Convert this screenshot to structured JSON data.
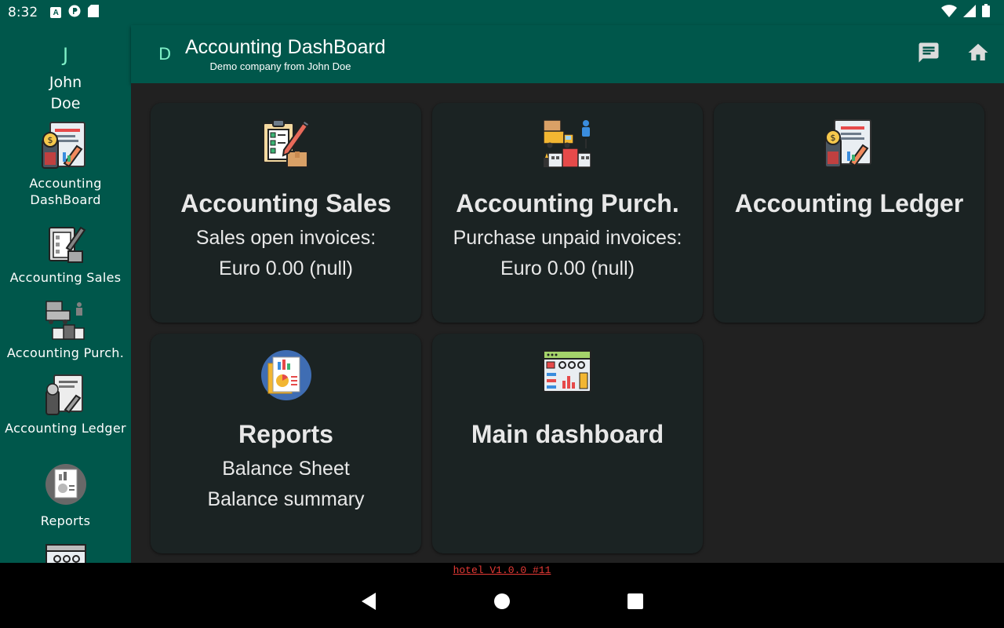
{
  "status_bar": {
    "time": "8:32",
    "icons": [
      "a-icon",
      "p-icon",
      "sd-card-icon"
    ],
    "right_icons": [
      "wifi-icon",
      "signal-icon",
      "battery-icon"
    ]
  },
  "sidebar": {
    "user_initial": "J",
    "user_first": "John",
    "user_last": "Doe",
    "items": [
      {
        "label": "Accounting DashBoard",
        "label_line1": "Accounting",
        "label_line2": "DashBoard",
        "icon": "accounting-dashboard-icon"
      },
      {
        "label": "Accounting Sales",
        "icon": "sales-clipboard-icon"
      },
      {
        "label": "Accounting Purch.",
        "icon": "purchase-truck-icon"
      },
      {
        "label": "Accounting Ledger",
        "icon": "ledger-icon"
      },
      {
        "label": "Reports",
        "icon": "reports-icon"
      },
      {
        "label": "",
        "icon": "main-dashboard-icon"
      }
    ]
  },
  "appbar": {
    "initial": "D",
    "title": "Accounting DashBoard",
    "subtitle": "Demo company from John Doe",
    "actions": [
      "chat-icon",
      "home-icon"
    ]
  },
  "cards": [
    {
      "title": "Accounting Sales",
      "line1": "Sales open invoices:",
      "line2": "Euro 0.00 (null)",
      "icon": "sales-clipboard-icon"
    },
    {
      "title": "Accounting Purch.",
      "line1": "Purchase unpaid invoices:",
      "line2": "Euro 0.00 (null)",
      "icon": "purchase-truck-icon"
    },
    {
      "title": "Accounting Ledger",
      "icon": "ledger-icon"
    },
    {
      "title": "Reports",
      "line1": "Balance Sheet",
      "line2": "Balance summary",
      "icon": "reports-icon"
    },
    {
      "title": "Main dashboard",
      "icon": "main-dashboard-icon"
    }
  ],
  "footer": {
    "version": "hotel V1.0.0 #11"
  },
  "colors": {
    "primary": "#00574b",
    "accent_initial": "#7ff0c8",
    "background": "#212121",
    "card": "#1b2323",
    "version_text": "#e53935"
  }
}
